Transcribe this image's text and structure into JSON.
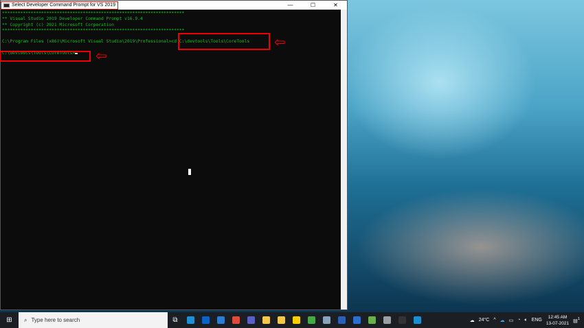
{
  "window": {
    "title": "Select Developer Command Prompt for VS 2019",
    "minimize": "—",
    "maximize": "☐",
    "close": "✕"
  },
  "terminal": {
    "lines": [
      "**********************************************************************",
      "** Visual Studio 2019 Developer Command Prompt v16.9.4",
      "** Copyright (c) 2021 Microsoft Corporation",
      "**********************************************************************",
      "",
      "C:\\Program Files (x86)\\Microsoft Visual Studio\\2019\\Professional>cd C:\\devtools\\Tools\\CoreTools",
      "",
      "C:\\devtools\\Tools\\CoreTools>"
    ]
  },
  "taskbar": {
    "search_placeholder": "Type here to search",
    "weather": "24°C",
    "language": "ENG",
    "time": "12:45 AM",
    "date": "13-07-2021",
    "notification_count": "1",
    "apps": [
      {
        "name": "edge",
        "color": "#1e90d6"
      },
      {
        "name": "outlook",
        "color": "#0a64c8"
      },
      {
        "name": "teams-people",
        "color": "#2b7cd3"
      },
      {
        "name": "chrome",
        "color": "#e04a3a"
      },
      {
        "name": "teams",
        "color": "#5b5fc7"
      },
      {
        "name": "file-explorer",
        "color": "#f3c74a"
      },
      {
        "name": "file-explorer-2",
        "color": "#f3c74a"
      },
      {
        "name": "sticky-notes",
        "color": "#f7d000"
      },
      {
        "name": "maps",
        "color": "#45a946"
      },
      {
        "name": "app-gray",
        "color": "#8aa3b8"
      },
      {
        "name": "word",
        "color": "#2b5fb8"
      },
      {
        "name": "word-2",
        "color": "#2b70d0"
      },
      {
        "name": "paint",
        "color": "#6ab04c"
      },
      {
        "name": "tool",
        "color": "#9aa0a6"
      },
      {
        "name": "command-prompt",
        "color": "#333333"
      },
      {
        "name": "chrome-2",
        "color": "#1a8fd0"
      }
    ]
  }
}
